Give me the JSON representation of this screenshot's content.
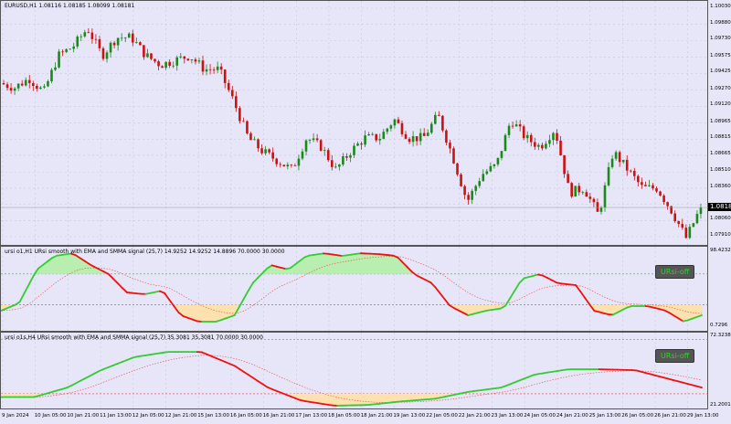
{
  "main": {
    "title": "EURUSD,H1  1.08116 1.08185 1.08099 1.08181",
    "current_price": "1.08181",
    "price_axis": [
      "1.10030",
      "1.09880",
      "1.09730",
      "1.09575",
      "1.09425",
      "1.09270",
      "1.09120",
      "1.08965",
      "1.08815",
      "1.08665",
      "1.08510",
      "1.08360",
      "1.08210",
      "1.08060",
      "1.07910"
    ],
    "price_path": [
      1.09335,
      1.09293,
      1.09378,
      1.09251,
      1.0959,
      1.09674,
      1.09844,
      1.0959,
      1.09759,
      1.09759,
      1.0959,
      1.09505,
      1.09547,
      1.0959,
      1.09463,
      1.09463,
      1.09166,
      1.08827,
      1.087,
      1.08616,
      1.08531,
      1.08827,
      1.08743,
      1.08531,
      1.087,
      1.08827,
      1.08827,
      1.08997,
      1.08827,
      1.08827,
      1.09039,
      1.08658,
      1.08234,
      1.08488,
      1.08573,
      1.08997,
      1.08827,
      1.08743,
      1.08912,
      1.08319,
      1.08361,
      1.08107,
      1.087,
      1.08531,
      1.08361,
      1.08361,
      1.0815,
      1.07896,
      1.08181
    ],
    "colors": {
      "bull": "#1a8a1a",
      "bear": "#cc1111"
    }
  },
  "p2": {
    "title": "ursi o1,H1 URsi smooth with EMA and SMMA signal (25,7) 14.9252 14.9252 14.8896 70.0000 30.0000",
    "axis_top": "98.4232",
    "axis_bottom": "0.7296",
    "button": "URsi-off",
    "range": [
      0.7296,
      98.4232
    ],
    "levels": [
      70,
      30
    ],
    "values": [
      22.2,
      31.7,
      75.8,
      93.6,
      97,
      81.7,
      69.8,
      46.0,
      43.6,
      48.4,
      16.2,
      7.9,
      7.9,
      16.2,
      57.9,
      81.7,
      75.8,
      93.6,
      97,
      93.6,
      97,
      96,
      93.6,
      69.8,
      57.9,
      28.1,
      16.2,
      22.2,
      25.7,
      63.9,
      69.8,
      57.9,
      55.5,
      22.2,
      16.2,
      28.1,
      28.1,
      22.2,
      7.9,
      16.2
    ]
  },
  "p3": {
    "title": "ursi o1s,H4 URsi smooth with EMA and SMMA signal (25,7) 35.3081 35.3081 70.0000 30.0000",
    "axis_top": "72.3238",
    "axis_bottom": "21.2001",
    "button": "URsi-off",
    "range": [
      21.2001,
      72.3238
    ],
    "levels": [
      70,
      30
    ],
    "values": [
      27.6,
      27.6,
      34.6,
      47.4,
      57.0,
      60.8,
      60.8,
      50.6,
      34.6,
      25.0,
      21.2,
      21.8,
      24.4,
      26.3,
      31.4,
      34.6,
      44.2,
      48.0,
      48.0,
      47.4,
      41.0,
      34.6
    ]
  },
  "time_axis": [
    "9 Jan 2024",
    "10 Jan 05:00",
    "10 Jan 21:00",
    "11 Jan 13:00",
    "12 Jan 05:00",
    "12 Jan 21:00",
    "15 Jan 13:00",
    "16 Jan 05:00",
    "16 Jan 21:00",
    "17 Jan 13:00",
    "18 Jan 05:00",
    "18 Jan 21:00",
    "19 Jan 13:00",
    "22 Jan 05:00",
    "22 Jan 21:00",
    "23 Jan 13:00",
    "24 Jan 05:00",
    "24 Jan 21:00",
    "25 Jan 13:00",
    "26 Jan 05:00",
    "26 Jan 21:00",
    "29 Jan 13:00"
  ]
}
